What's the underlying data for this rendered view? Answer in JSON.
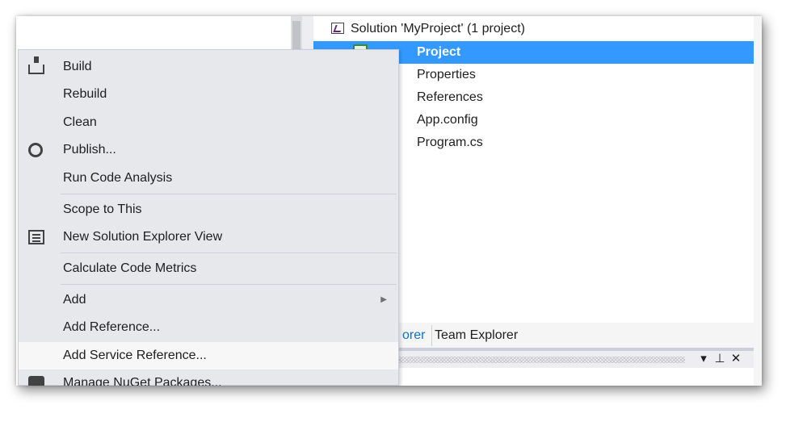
{
  "solution_explorer": {
    "items": [
      {
        "label": "Solution 'MyProject' (1 project)"
      },
      {
        "label": "Project"
      },
      {
        "label": "Properties"
      },
      {
        "label": "References"
      },
      {
        "label": "App.config"
      },
      {
        "label": "Program.cs"
      }
    ],
    "tabs": [
      {
        "label": "orer"
      },
      {
        "label": "Team Explorer"
      }
    ],
    "panel_buttons": {
      "dropdown": "▾",
      "pin": "⊥",
      "close": "✕"
    }
  },
  "context_menu": {
    "items": [
      {
        "label": "Build",
        "icon": "build-icon"
      },
      {
        "label": "Rebuild"
      },
      {
        "label": "Clean"
      },
      {
        "label": "Publish...",
        "icon": "publish-globe-icon"
      },
      {
        "label": "Run Code Analysis"
      },
      {
        "label": "Scope to This"
      },
      {
        "label": "New Solution Explorer View",
        "icon": "new-view-icon"
      },
      {
        "label": "Calculate Code Metrics"
      },
      {
        "label": "Add",
        "submenu_arrow": "▶"
      },
      {
        "label": "Add Reference..."
      },
      {
        "label": "Add Service Reference..."
      },
      {
        "label": "Manage NuGet Packages...",
        "icon": "nuget-icon"
      }
    ]
  },
  "colors": {
    "selection": "#3399ff",
    "menu_background": "#e7e8ec",
    "menu_hover": "#f7f7f8",
    "link_tab": "#0e70c0"
  }
}
